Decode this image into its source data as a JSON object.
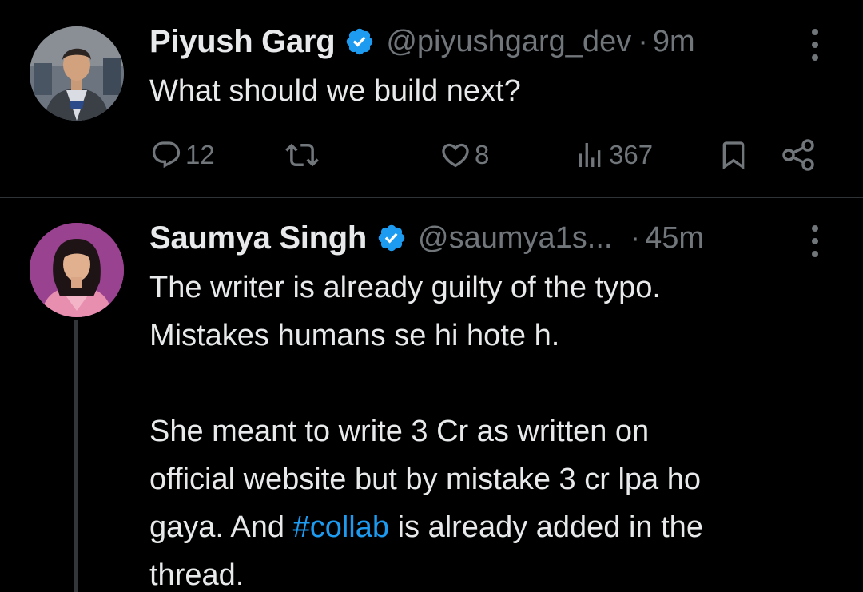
{
  "tweets": [
    {
      "display_name": "Piyush Garg",
      "handle": "@piyushgarg_dev",
      "separator": "·",
      "time": "9m",
      "body_lines": [
        "What should we build next?"
      ],
      "actions": {
        "replies": "12",
        "likes": "8",
        "views": "367"
      }
    },
    {
      "display_name": "Saumya Singh",
      "handle": "@saumya1s...",
      "separator": "·",
      "time": "45m",
      "body": {
        "line1": "The writer is already guilty of the typo.",
        "line2": "Mistakes humans se hi hote h.",
        "line3": "She meant to write 3 Cr as written on",
        "line4": "official website but by mistake 3 cr lpa ho",
        "line5_before": "gaya. And ",
        "line5_hashtag": "#collab",
        "line5_after": " is already added in the",
        "line6": "thread."
      }
    }
  ],
  "icons": {
    "verified": "verified-badge-icon",
    "more": "more-options-icon",
    "reply": "reply-icon",
    "retweet": "retweet-icon",
    "like": "heart-icon",
    "views": "views-icon",
    "bookmark": "bookmark-icon",
    "share": "share-icon"
  },
  "colors": {
    "background": "#000000",
    "text": "#e7e9ea",
    "secondary": "#71767b",
    "accent": "#1d9bf0",
    "divider": "#2f3336"
  }
}
